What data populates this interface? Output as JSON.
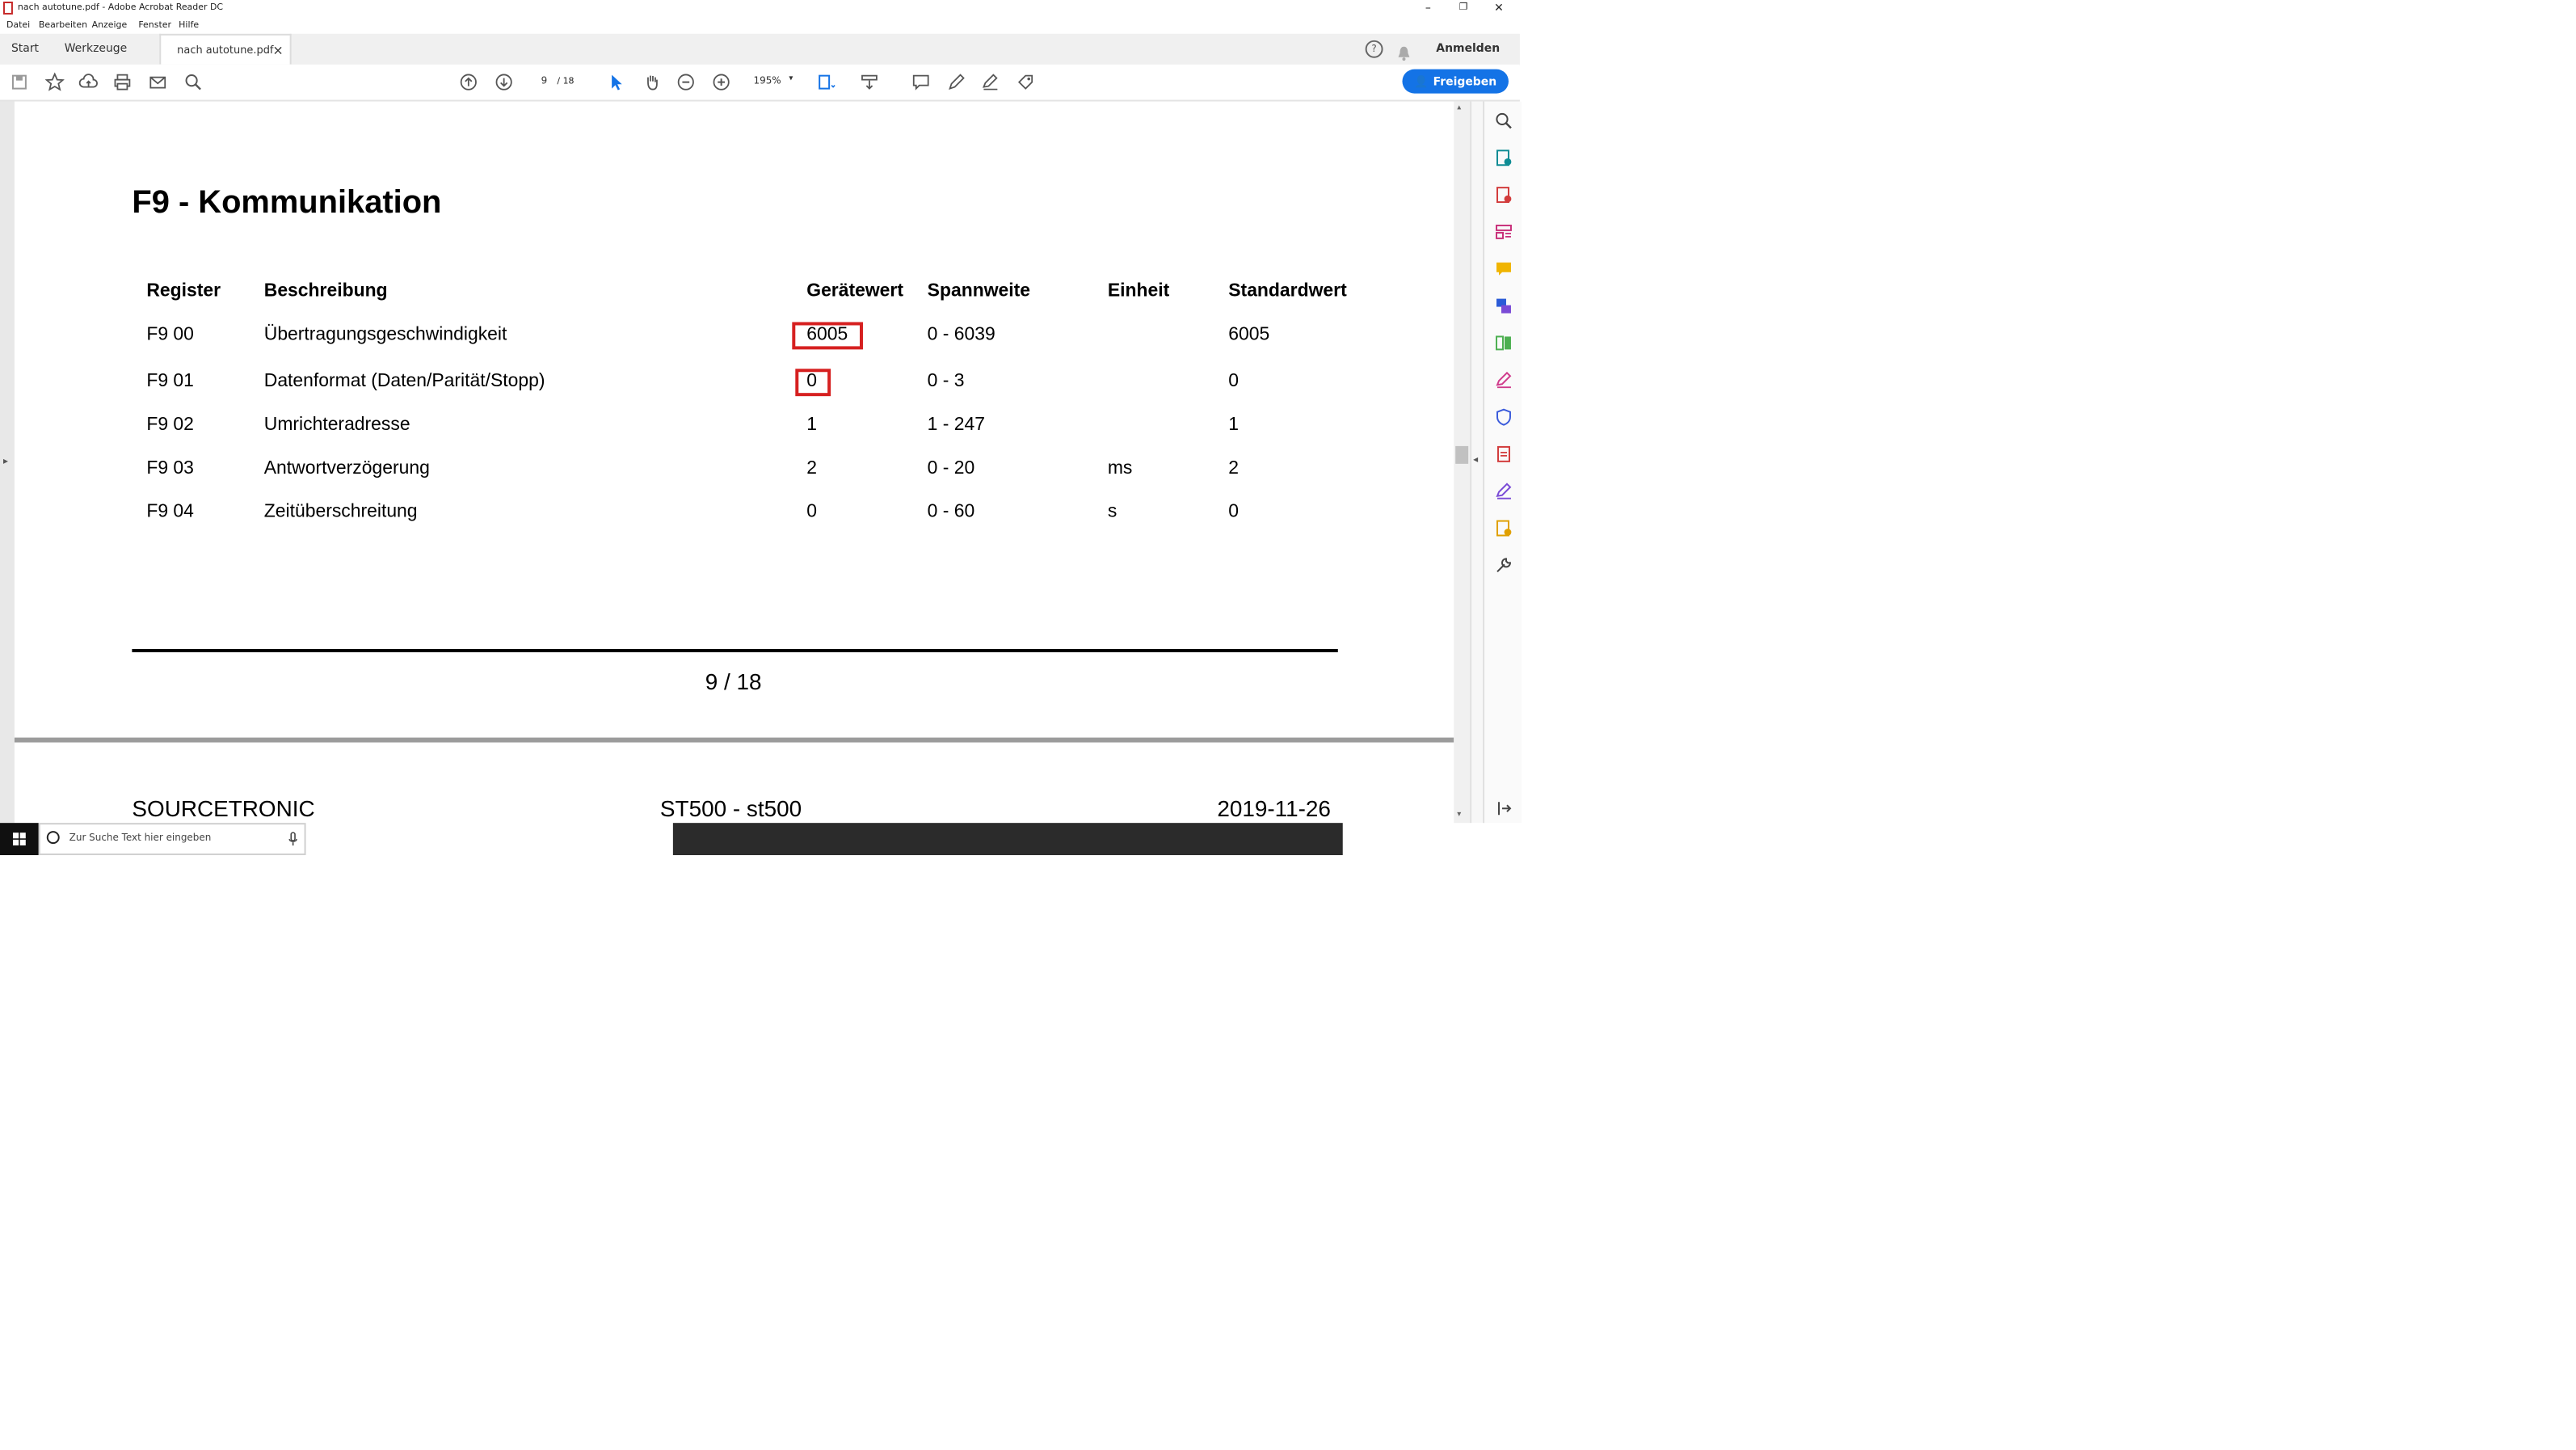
{
  "window": {
    "title": "nach autotune.pdf - Adobe Acrobat Reader DC",
    "minimize": "–",
    "restore": "❐",
    "close": "✕"
  },
  "menu": [
    "Datei",
    "Bearbeiten",
    "Anzeige",
    "Fenster",
    "Hilfe"
  ],
  "tabs": {
    "start": "Start",
    "tools": "Werkzeuge",
    "document": "nach autotune.pdf",
    "document_close": "×"
  },
  "header_right": {
    "help_icon": "help-icon",
    "bell_icon": "bell-icon",
    "signin": "Anmelden"
  },
  "toolbar": {
    "page_current": "9",
    "page_total": "/ 18",
    "zoom": "195%",
    "share": "Freigeben"
  },
  "document": {
    "heading": "F9 - Kommunikation",
    "columns": [
      "Register",
      "Beschreibung",
      "Gerätewert",
      "Spannweite",
      "Einheit",
      "Standardwert"
    ],
    "rows": [
      {
        "register": "F9 00",
        "description": "Übertragungsgeschwindigkeit",
        "value": "6005",
        "range": "0 - 6039",
        "unit": "",
        "default": "6005"
      },
      {
        "register": "F9 01",
        "description": "Datenformat (Daten/Parität/Stopp)",
        "value": "0",
        "range": "0 - 3",
        "unit": "",
        "default": "0"
      },
      {
        "register": "F9 02",
        "description": "Umrichteradresse",
        "value": "1",
        "range": "1 - 247",
        "unit": "",
        "default": "1"
      },
      {
        "register": "F9 03",
        "description": "Antwortverzögerung",
        "value": "2",
        "range": "0 - 20",
        "unit": "ms",
        "default": "2"
      },
      {
        "register": "F9 04",
        "description": "Zeitüberschreitung",
        "value": "0",
        "range": "0 - 60",
        "unit": "s",
        "default": "0"
      }
    ],
    "page_number": "9 / 18",
    "footer": {
      "company": "SOURCETRONIC",
      "product": "ST500 - st500",
      "date": "2019-11-26"
    }
  },
  "taskbar": {
    "search_placeholder": "Zur Suche Text hier eingeben"
  },
  "colors": {
    "accent": "#1473e6",
    "highlight_box": "#d62020"
  }
}
